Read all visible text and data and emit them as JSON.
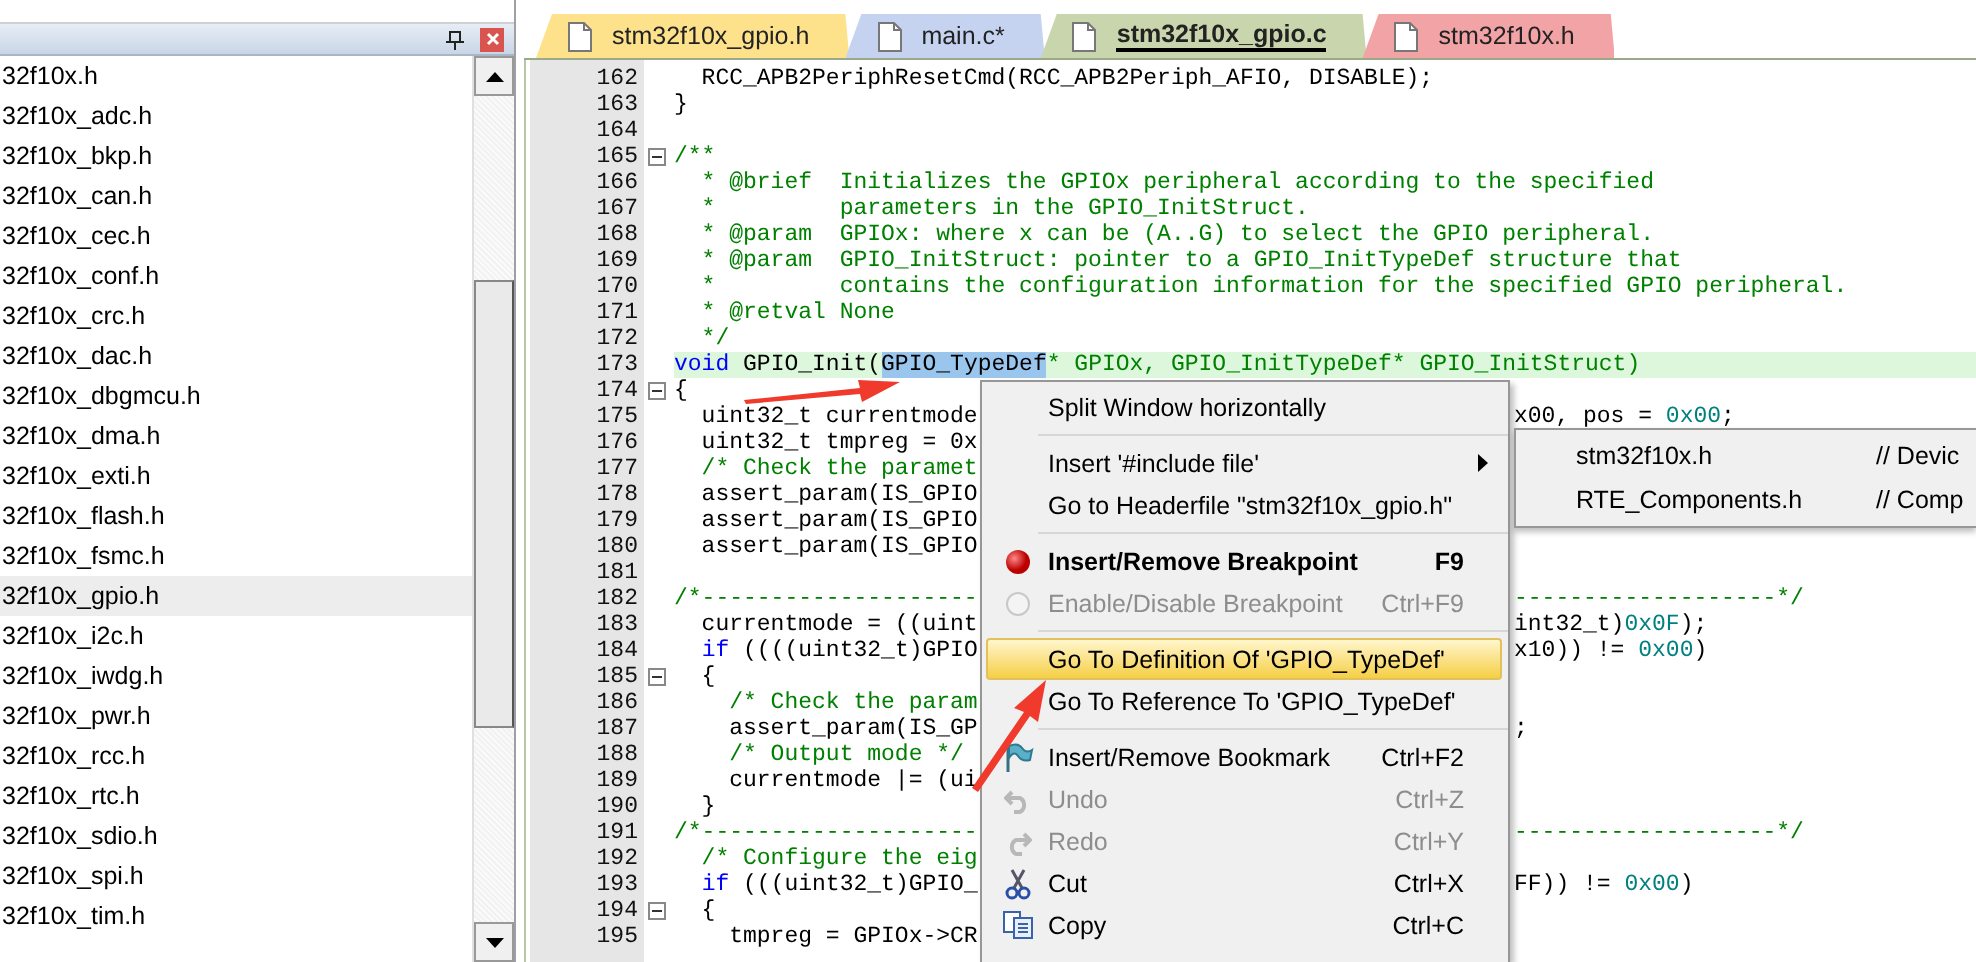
{
  "sidebar": {
    "items": [
      {
        "label": "32f10x.h",
        "selected": false
      },
      {
        "label": "32f10x_adc.h",
        "selected": false
      },
      {
        "label": "32f10x_bkp.h",
        "selected": false
      },
      {
        "label": "32f10x_can.h",
        "selected": false
      },
      {
        "label": "32f10x_cec.h",
        "selected": false
      },
      {
        "label": "32f10x_conf.h",
        "selected": false
      },
      {
        "label": "32f10x_crc.h",
        "selected": false
      },
      {
        "label": "32f10x_dac.h",
        "selected": false
      },
      {
        "label": "32f10x_dbgmcu.h",
        "selected": false
      },
      {
        "label": "32f10x_dma.h",
        "selected": false
      },
      {
        "label": "32f10x_exti.h",
        "selected": false
      },
      {
        "label": "32f10x_flash.h",
        "selected": false
      },
      {
        "label": "32f10x_fsmc.h",
        "selected": false
      },
      {
        "label": "32f10x_gpio.h",
        "selected": true
      },
      {
        "label": "32f10x_i2c.h",
        "selected": false
      },
      {
        "label": "32f10x_iwdg.h",
        "selected": false
      },
      {
        "label": "32f10x_pwr.h",
        "selected": false
      },
      {
        "label": "32f10x_rcc.h",
        "selected": false
      },
      {
        "label": "32f10x_rtc.h",
        "selected": false
      },
      {
        "label": "32f10x_sdio.h",
        "selected": false
      },
      {
        "label": "32f10x_spi.h",
        "selected": false
      },
      {
        "label": "32f10x_tim.h",
        "selected": false
      }
    ]
  },
  "tabs": [
    {
      "label": "stm32f10x_gpio.h",
      "selected": false,
      "color": "#fde28b"
    },
    {
      "label": "main.c*",
      "selected": false,
      "color": "#c6d3f0"
    },
    {
      "label": "stm32f10x_gpio.c",
      "selected": true,
      "color": "#c9d6ad"
    },
    {
      "label": "stm32f10x.h",
      "selected": false,
      "color": "#f1a3a6"
    }
  ],
  "code_lines": [
    {
      "number": "162",
      "text": "  RCC_APB2PeriphResetCmd(RCC_APB2Periph_AFIO, DISABLE);"
    },
    {
      "number": "163",
      "text": "}"
    },
    {
      "number": "164"
    },
    {
      "number": "165",
      "text": "/**",
      "fold": true
    },
    {
      "number": "166",
      "text": "  * @brief  Initializes the GPIOx peripheral according to the specified"
    },
    {
      "number": "167",
      "text": "  *         parameters in the GPIO_InitStruct."
    },
    {
      "number": "168",
      "text": "  * @param  GPIOx: where x can be (A..G) to select the GPIO peripheral."
    },
    {
      "number": "169",
      "text": "  * @param  GPIO_InitStruct: pointer to a GPIO_InitTypeDef structure that"
    },
    {
      "number": "170",
      "text": "  *         contains the configuration information for the specified GPIO peripheral."
    },
    {
      "number": "171",
      "text": "  * @retval None"
    },
    {
      "number": "172",
      "text": "  */"
    },
    {
      "number": "173",
      "text": "void GPIO_Init(",
      "selection": "GPIO_TypeDef",
      "after": "* GPIOx, GPIO_InitTypeDef* GPIO_InitStruct)",
      "current": true
    },
    {
      "number": "174",
      "text": "{",
      "fold": true
    },
    {
      "number": "175",
      "text": "  uint32_t currentmode",
      "right": "x00, pos = 0x00;"
    },
    {
      "number": "176",
      "text": "  uint32_t tmpreg = 0x"
    },
    {
      "number": "177",
      "text": "  /* Check the paramet"
    },
    {
      "number": "178",
      "text": "  assert_param(IS_GPIO"
    },
    {
      "number": "179",
      "text": "  assert_param(IS_GPIO"
    },
    {
      "number": "180",
      "text": "  assert_param(IS_GPIO"
    },
    {
      "number": "181"
    },
    {
      "number": "182",
      "text": "/*--------------------",
      "right": "-------------------*/"
    },
    {
      "number": "183",
      "text": "  currentmode = ((uint",
      "right": "int32_t)0x0F);"
    },
    {
      "number": "184",
      "text": "  if ((((uint32_t)GPIO",
      "right": "x10)) != 0x00)"
    },
    {
      "number": "185",
      "text": "  {",
      "fold": true
    },
    {
      "number": "186",
      "text": "    /* Check the param"
    },
    {
      "number": "187",
      "text": "    assert_param(IS_GP",
      "right": ";"
    },
    {
      "number": "188",
      "text": "    /* Output mode */"
    },
    {
      "number": "189",
      "text": "    currentmode |= (ui"
    },
    {
      "number": "190",
      "text": "  }"
    },
    {
      "number": "191",
      "text": "/*--------------------",
      "right": "-------------------*/"
    },
    {
      "number": "192",
      "text": "  /* Configure the eig"
    },
    {
      "number": "193",
      "text": "  if (((uint32_t)GPIO_",
      "right": "FF)) != 0x00)"
    },
    {
      "number": "194",
      "text": "  {",
      "fold": true
    },
    {
      "number": "195",
      "text": "    tmpreg = GPIOx->CR"
    }
  ],
  "context_menu": {
    "items": [
      {
        "kind": "item",
        "label": "Split Window horizontally"
      },
      {
        "kind": "separator"
      },
      {
        "kind": "item",
        "label": "Insert '#include file'",
        "submenu": true
      },
      {
        "kind": "item",
        "label": "Go to Headerfile \"stm32f10x_gpio.h\""
      },
      {
        "kind": "separator"
      },
      {
        "kind": "breakpoint",
        "label": "Insert/Remove Breakpoint",
        "shortcut": "F9",
        "bold": true
      },
      {
        "kind": "toggle",
        "label": "Enable/Disable Breakpoint",
        "shortcut": "Ctrl+F9",
        "disabled": true
      },
      {
        "kind": "separator"
      },
      {
        "kind": "item",
        "label": "Go To Definition Of 'GPIO_TypeDef'",
        "selected": true
      },
      {
        "kind": "item",
        "label": "Go To Reference To 'GPIO_TypeDef'",
        "selected": false
      },
      {
        "kind": "separator"
      },
      {
        "kind": "bookmark",
        "label": "Insert/Remove Bookmark",
        "shortcut": "Ctrl+F2"
      },
      {
        "kind": "undo",
        "label": "Undo",
        "shortcut": "Ctrl+Z",
        "disabled": true
      },
      {
        "kind": "redo",
        "label": "Redo",
        "shortcut": "Ctrl+Y",
        "disabled": true
      },
      {
        "kind": "cut",
        "label": "Cut",
        "shortcut": "Ctrl+X"
      },
      {
        "kind": "copy",
        "label": "Copy",
        "shortcut": "Ctrl+C"
      }
    ]
  },
  "submenu": {
    "items": [
      {
        "file": "stm32f10x.h",
        "comment": "// Devic"
      },
      {
        "file": "RTE_Components.h",
        "comment": "// Comp"
      }
    ]
  }
}
